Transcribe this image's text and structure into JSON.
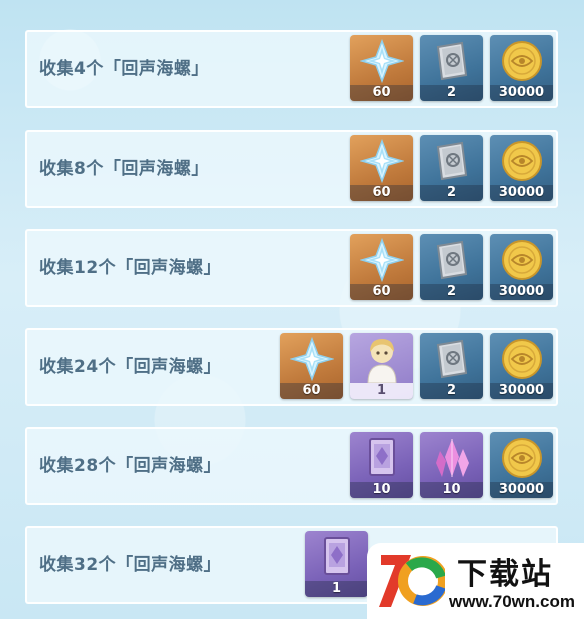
{
  "rows": [
    {
      "label": "收集4个「回声海螺」",
      "rewards": [
        {
          "icon": "primogem-icon",
          "rarity": "r5",
          "qty": "60"
        },
        {
          "icon": "book-icon",
          "rarity": "r3",
          "qty": "2"
        },
        {
          "icon": "mora-coin-icon",
          "rarity": "r3",
          "qty": "30000"
        }
      ]
    },
    {
      "label": "收集8个「回声海螺」",
      "rewards": [
        {
          "icon": "primogem-icon",
          "rarity": "r5",
          "qty": "60"
        },
        {
          "icon": "book-icon",
          "rarity": "r3",
          "qty": "2"
        },
        {
          "icon": "mora-coin-icon",
          "rarity": "r3",
          "qty": "30000"
        }
      ]
    },
    {
      "label": "收集12个「回声海螺」",
      "rewards": [
        {
          "icon": "primogem-icon",
          "rarity": "r5",
          "qty": "60"
        },
        {
          "icon": "book-icon",
          "rarity": "r3",
          "qty": "2"
        },
        {
          "icon": "mora-coin-icon",
          "rarity": "r3",
          "qty": "30000"
        }
      ]
    },
    {
      "label": "收集24个「回声海螺」",
      "rewards": [
        {
          "icon": "primogem-icon",
          "rarity": "r5",
          "qty": "60"
        },
        {
          "icon": "character-card-icon",
          "rarity": "r4c",
          "qty": "1"
        },
        {
          "icon": "book-icon",
          "rarity": "r3",
          "qty": "2"
        },
        {
          "icon": "mora-coin-icon",
          "rarity": "r3",
          "qty": "30000"
        }
      ]
    },
    {
      "label": "收集28个「回声海螺」",
      "rewards": [
        {
          "icon": "purple-book-icon",
          "rarity": "r4",
          "qty": "10"
        },
        {
          "icon": "crystal-icon",
          "rarity": "r4",
          "qty": "10"
        },
        {
          "icon": "mora-coin-icon",
          "rarity": "r3",
          "qty": "30000"
        }
      ]
    },
    {
      "label": "收集32个「回声海螺」",
      "rewards": [
        {
          "icon": "purple-book-icon",
          "rarity": "r4",
          "qty": "1"
        }
      ]
    }
  ],
  "watermark": {
    "logo_icon": "70-logo-icon",
    "title": "下载站",
    "url": "www.70wn.com"
  }
}
